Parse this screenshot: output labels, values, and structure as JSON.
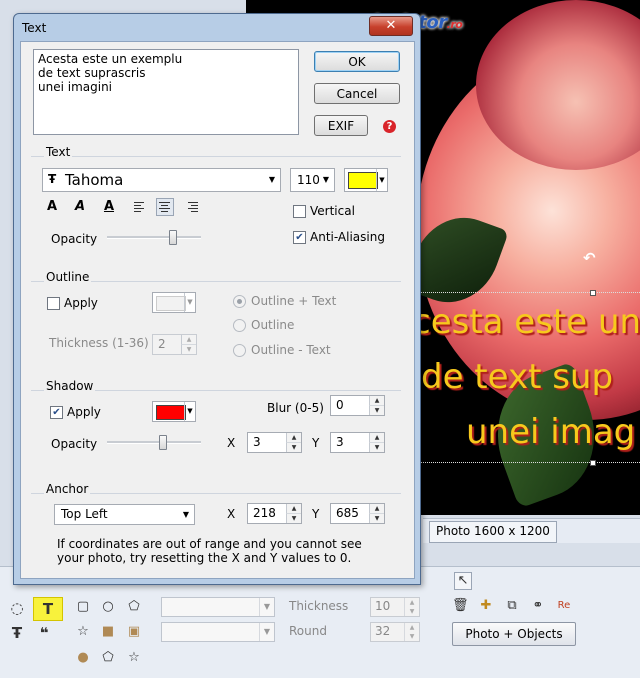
{
  "watermark": {
    "main": "programecalculator",
    "suffix": ".ro"
  },
  "overlay_text": [
    "cesta este un",
    "de text sup",
    "unei imag"
  ],
  "status": {
    "photo_size": "Photo 1600 x 1200"
  },
  "bottom_toolbar": {
    "thickness_label": "Thickness",
    "thickness_value": "10",
    "round_label": "Round",
    "round_value": "32",
    "photo_objects_button": "Photo + Objects"
  },
  "dialog": {
    "title": "Text",
    "close_label": "✕",
    "text_content": "Acesta este un exemplu\nde text suprascris\nunei imagini",
    "ok_label": "OK",
    "cancel_label": "Cancel",
    "exif_label": "EXIF",
    "help_icon": "question-icon",
    "text_group": {
      "title": "Text",
      "font_name": "Tahoma",
      "font_size": "110",
      "color": "#ffff00",
      "vertical_label": "Vertical",
      "vertical_checked": false,
      "antialias_label": "Anti-Aliasing",
      "antialias_checked": true,
      "opacity_label": "Opacity",
      "opacity_value": 0.72
    },
    "outline_group": {
      "title": "Outline",
      "apply_label": "Apply",
      "apply_checked": false,
      "thickness_label": "Thickness (1-36)",
      "thickness_value": "2",
      "options": [
        "Outline + Text",
        "Outline",
        "Outline - Text"
      ],
      "selected_option": 0
    },
    "shadow_group": {
      "title": "Shadow",
      "apply_label": "Apply",
      "apply_checked": true,
      "color": "#ff0000",
      "blur_label": "Blur (0-5)",
      "blur_value": "0",
      "opacity_label": "Opacity",
      "opacity_value": 0.6,
      "x_label": "X",
      "x_value": "3",
      "y_label": "Y",
      "y_value": "3"
    },
    "anchor_group": {
      "title": "Anchor",
      "anchor_value": "Top Left",
      "x_label": "X",
      "x_value": "218",
      "y_label": "Y",
      "y_value": "685",
      "note": "If coordinates are out of range and you cannot see\nyour photo, try resetting the X and Y values to 0."
    }
  }
}
